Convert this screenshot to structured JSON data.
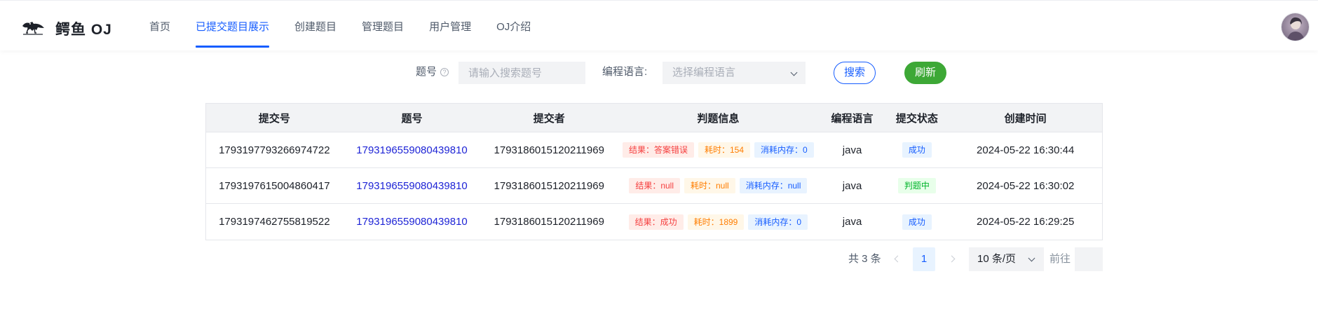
{
  "header": {
    "brand": "鳄鱼 OJ",
    "nav": [
      {
        "label": "首页",
        "active": false
      },
      {
        "label": "已提交题目展示",
        "active": true
      },
      {
        "label": "创建题目",
        "active": false
      },
      {
        "label": "管理题目",
        "active": false
      },
      {
        "label": "用户管理",
        "active": false
      },
      {
        "label": "OJ介绍",
        "active": false
      }
    ]
  },
  "search": {
    "question_label": "题号",
    "question_placeholder": "请输入搜索题号",
    "language_label": "编程语言:",
    "language_placeholder": "选择编程语言",
    "search_button": "搜索",
    "refresh_button": "刷新"
  },
  "table": {
    "headers": [
      "提交号",
      "题号",
      "提交者",
      "判题信息",
      "编程语言",
      "提交状态",
      "创建时间"
    ],
    "rows": [
      {
        "submit_id": "1793197793266974722",
        "question_id": "1793196559080439810",
        "user_id": "1793186015120211969",
        "result": "结果：答案错误",
        "time": "耗时：154",
        "memory": "消耗内存：0",
        "language": "java",
        "status": "成功",
        "status_type": "blue",
        "created": "2024-05-22 16:30:44"
      },
      {
        "submit_id": "1793197615004860417",
        "question_id": "1793196559080439810",
        "user_id": "1793186015120211969",
        "result": "结果：null",
        "time": "耗时：null",
        "memory": "消耗内存：null",
        "language": "java",
        "status": "判题中",
        "status_type": "green",
        "created": "2024-05-22 16:30:02"
      },
      {
        "submit_id": "1793197462755819522",
        "question_id": "1793196559080439810",
        "user_id": "1793186015120211969",
        "result": "结果：成功",
        "time": "耗时：1899",
        "memory": "消耗内存：0",
        "language": "java",
        "status": "成功",
        "status_type": "blue",
        "created": "2024-05-22 16:29:25"
      }
    ]
  },
  "pagination": {
    "total": "共 3 条",
    "current_page": "1",
    "page_size": "10 条/页",
    "goto_label": "前往"
  },
  "colors": {
    "primary": "#165dff",
    "refresh": "#3da836",
    "link": "#1e24d6"
  }
}
